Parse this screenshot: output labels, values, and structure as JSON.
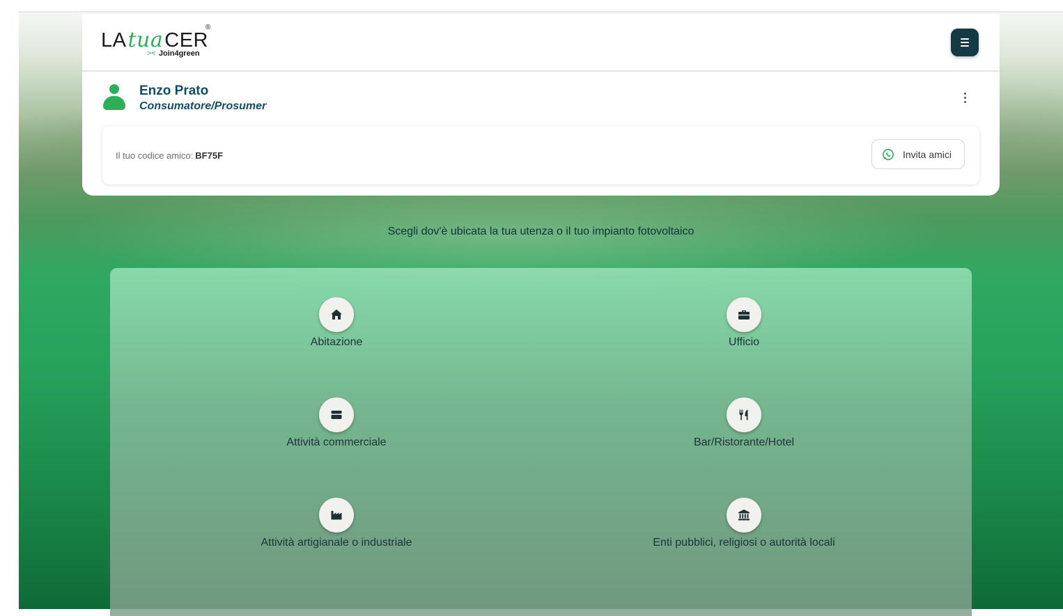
{
  "brand": {
    "logo_prefix": "LA",
    "logo_script": "tua",
    "logo_suffix": "CER",
    "logo_registered": "®",
    "logo_sub_arrows": "><",
    "logo_sub_text": "Join4green",
    "accent_color": "#2fae5a",
    "dark_color": "#133a45"
  },
  "header": {
    "menu_icon": "hamburger-menu-icon"
  },
  "profile": {
    "name": "Enzo Prato",
    "role": "Consumatore/Prosumer",
    "options_icon": "vertical-dots-icon",
    "referral_label": "Il tuo codice amico:",
    "referral_code": "BF75F",
    "invite_button": "Invita amici",
    "invite_icon": "whatsapp-icon"
  },
  "prompt": "Scegli dov'è ubicata la tua utenza o il tuo impianto fotovoltaico",
  "options": [
    {
      "label": "Abitazione",
      "icon": "house-icon"
    },
    {
      "label": "Ufficio",
      "icon": "briefcase-icon"
    },
    {
      "label": "Attività commerciale",
      "icon": "store-icon"
    },
    {
      "label": "Bar/Ristorante/Hotel",
      "icon": "utensils-icon"
    },
    {
      "label": "Attività artigianale o industriale",
      "icon": "factory-icon"
    },
    {
      "label": "Enti pubblici, religiosi o autorità locali",
      "icon": "landmark-icon"
    }
  ]
}
